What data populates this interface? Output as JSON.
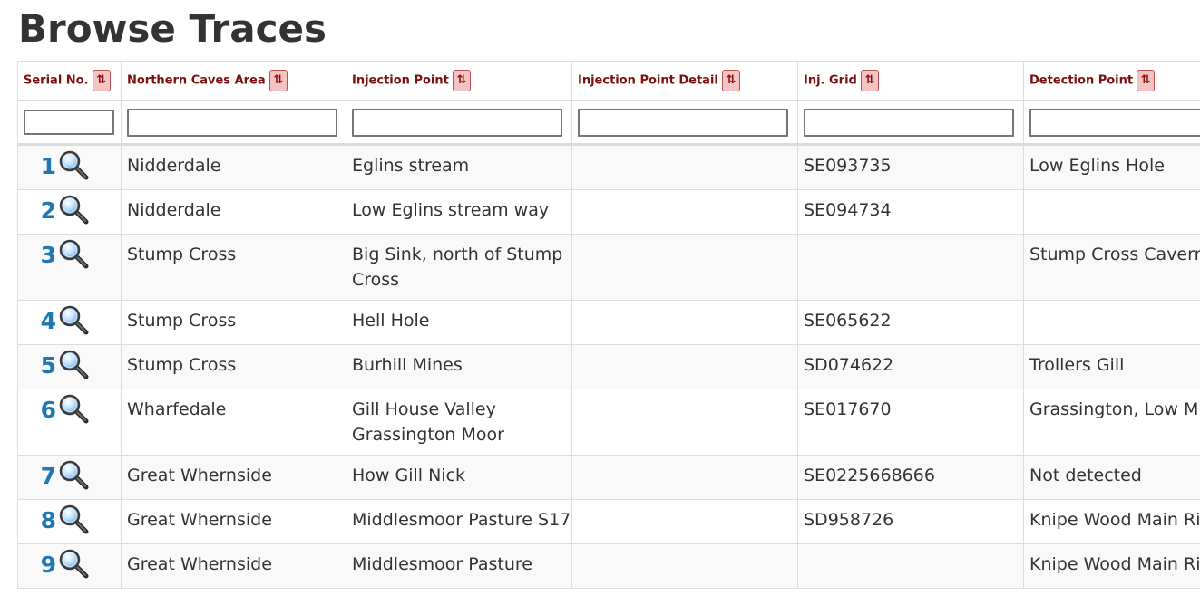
{
  "page": {
    "title": "Browse Traces"
  },
  "table": {
    "headers": [
      "Serial No.",
      "Northern Caves Area",
      "Injection Point",
      "Injection Point Detail",
      "Inj. Grid",
      "Detection Point"
    ],
    "sort_icon": "sort-up-down-icon",
    "filters": [
      "",
      "",
      "",
      "",
      "",
      ""
    ],
    "rows": [
      {
        "serial": "1",
        "area": "Nidderdale",
        "injection_point": "Eglins stream",
        "injection_detail": "",
        "inj_grid": "SE093735",
        "detection_point": "Low Eglins Hole"
      },
      {
        "serial": "2",
        "area": "Nidderdale",
        "injection_point": "Low Eglins stream way",
        "injection_detail": "",
        "inj_grid": "SE094734",
        "detection_point": ""
      },
      {
        "serial": "3",
        "area": "Stump Cross",
        "injection_point": "Big Sink, north of Stump Cross",
        "injection_detail": "",
        "inj_grid": "",
        "detection_point": "Stump Cross Cavern"
      },
      {
        "serial": "4",
        "area": "Stump Cross",
        "injection_point": "Hell Hole",
        "injection_detail": "",
        "inj_grid": "SE065622",
        "detection_point": ""
      },
      {
        "serial": "5",
        "area": "Stump Cross",
        "injection_point": "Burhill Mines",
        "injection_detail": "",
        "inj_grid": "SD074622",
        "detection_point": "Trollers Gill"
      },
      {
        "serial": "6",
        "area": "Wharfedale",
        "injection_point": "Gill House Valley Grassington Moor",
        "injection_detail": "",
        "inj_grid": "SE017670",
        "detection_point": "Grassington, Low Mi"
      },
      {
        "serial": "7",
        "area": "Great Whernside",
        "injection_point": "How Gill Nick",
        "injection_detail": "",
        "inj_grid": "SE0225668666",
        "detection_point": "Not detected"
      },
      {
        "serial": "8",
        "area": "Great Whernside",
        "injection_point": "Middlesmoor Pasture S17",
        "injection_detail": "",
        "inj_grid": "SD958726",
        "detection_point": "Knipe Wood Main Ri"
      },
      {
        "serial": "9",
        "area": "Great Whernside",
        "injection_point": "Middlesmoor Pasture",
        "injection_detail": "",
        "inj_grid": "",
        "detection_point": "Knipe Wood Main Ri"
      }
    ]
  },
  "colors": {
    "header_text": "#7a1010",
    "sort_button_bg": "#f4c4c4",
    "sort_button_border": "#c05050",
    "serial_link": "#1f78b4",
    "zebra_row": "#f9f9f9",
    "border": "#dddddd"
  }
}
